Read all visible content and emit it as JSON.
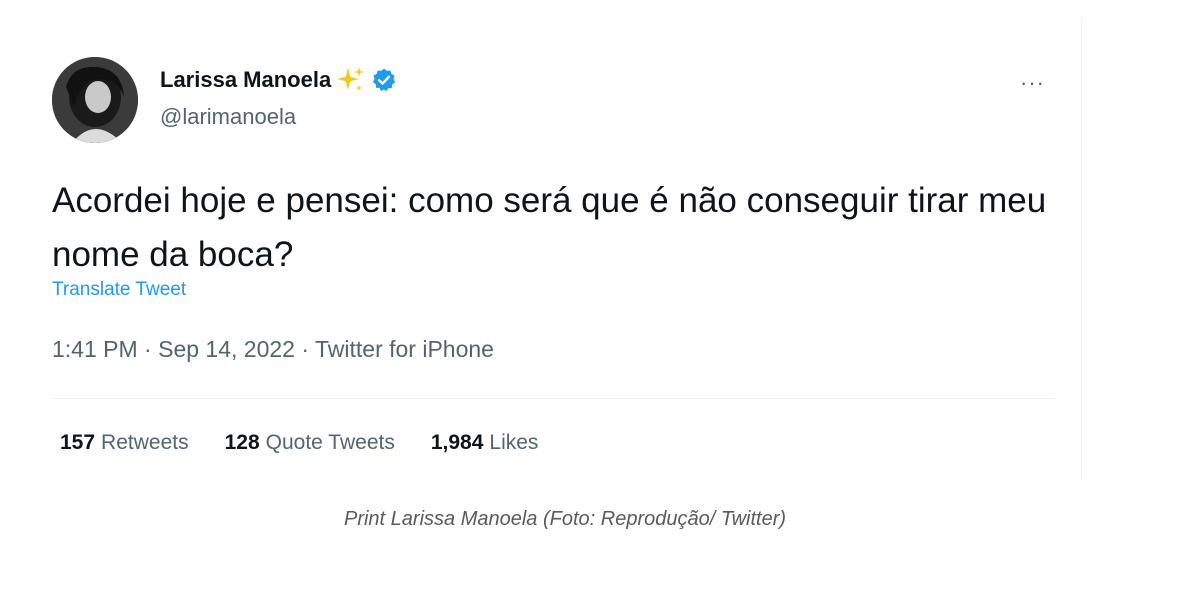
{
  "tweet": {
    "display_name": "Larissa Manoela",
    "handle": "@larimanoela",
    "more_label": "···",
    "text": "Acordei hoje e pensei: como será que é não conseguir tirar meu nome da boca?",
    "translate_label": "Translate Tweet",
    "time": "1:41 PM",
    "date": "Sep 14, 2022",
    "separator": "·",
    "source": "Twitter for iPhone",
    "stats": {
      "retweets_count": "157",
      "retweets_label": "Retweets",
      "quote_count": "128",
      "quote_label": "Quote Tweets",
      "likes_count": "1,984",
      "likes_label": "Likes"
    }
  },
  "caption": "Print Larissa Manoela (Foto: Reprodução/ Twitter)",
  "colors": {
    "accent": "#1d9bf0",
    "secondary_text": "#536471",
    "sparkle": "#f5c518"
  },
  "icons": {
    "sparkle": "sparkles-emoji-icon",
    "verified": "verified-badge-icon",
    "more": "more-horizontal-icon"
  }
}
